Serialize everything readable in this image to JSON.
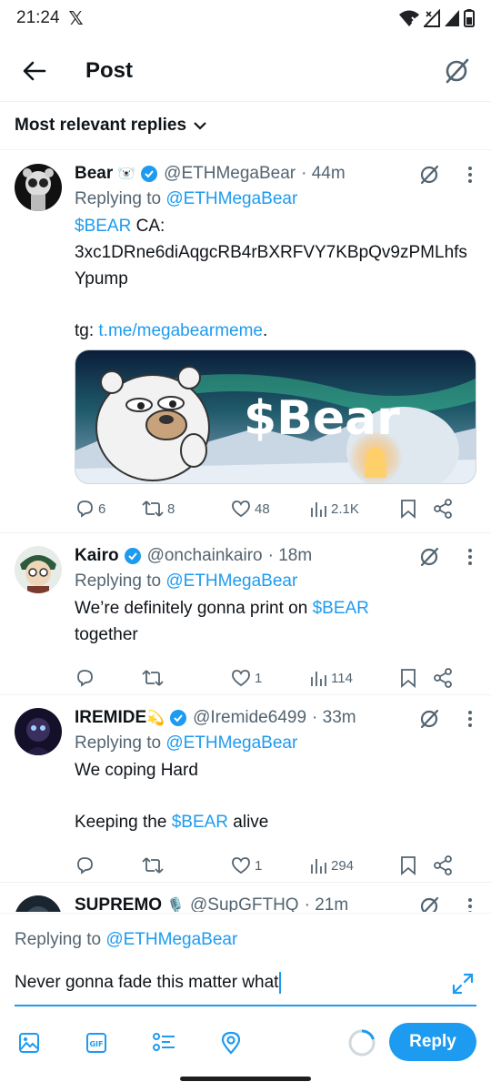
{
  "status_bar": {
    "time": "21:24",
    "x_logo": "𝕏",
    "icons": [
      "wifi-x-icon",
      "signal-x-icon",
      "signal-icon",
      "battery-icon"
    ]
  },
  "header": {
    "title": "Post",
    "back_icon": "arrow-left-icon",
    "grok_icon": "grok-icon"
  },
  "sort": {
    "label": "Most relevant replies"
  },
  "tweets": [
    {
      "name": "Bear",
      "emoji": "🐻‍❄️",
      "handle": "@ETHMegaBear",
      "time": "· 44m",
      "replying_prefix": "Replying to ",
      "replying_to": "@ETHMegaBear",
      "text": {
        "cashtag": "$BEAR",
        "line1_rest": " CA:",
        "line2": "3xc1DRne6diAqgcRB4rBXRFVY7KBpQv9zPMLhfsYpump",
        "tg_prefix": "tg: ",
        "tg_link": "t.me/megabearmeme",
        "tg_suffix": "."
      },
      "media_text": "$Bear",
      "stats": {
        "replies": "6",
        "retweets": "8",
        "likes": "48",
        "views": "2.1K"
      }
    },
    {
      "name": "Kairo",
      "handle": "@onchainkairo",
      "time": "· 18m",
      "replying_prefix": "Replying to ",
      "replying_to": "@ETHMegaBear",
      "text": {
        "before": "We’re definitely gonna print on ",
        "cashtag": "$BEAR",
        "after": "together"
      },
      "stats": {
        "replies": "",
        "retweets": "",
        "likes": "1",
        "views": "114"
      }
    },
    {
      "name": "IREMIDE",
      "emoji": "💫",
      "handle": "@Iremide6499",
      "time": "· 33m",
      "replying_prefix": "Replying to ",
      "replying_to": "@ETHMegaBear",
      "text": {
        "line1": "We coping Hard",
        "before": "Keeping the ",
        "cashtag": "$BEAR",
        "after": " alive"
      },
      "stats": {
        "replies": "",
        "retweets": "",
        "likes": "1",
        "views": "294"
      }
    },
    {
      "name": "SUPREMO",
      "emoji": "🎙️",
      "handle": "@SupGFTHQ",
      "time": "· 21m"
    }
  ],
  "composer": {
    "replying_prefix": "Replying to ",
    "replying_to": "@ETHMegaBear",
    "value": "Never gonna fade this matter what",
    "reply_label": "Reply",
    "tools": [
      "image-icon",
      "gif-icon",
      "poll-icon",
      "location-icon"
    ]
  },
  "colors": {
    "accent": "#1d9bf0",
    "text": "#0f1419",
    "secondary": "#536471"
  }
}
